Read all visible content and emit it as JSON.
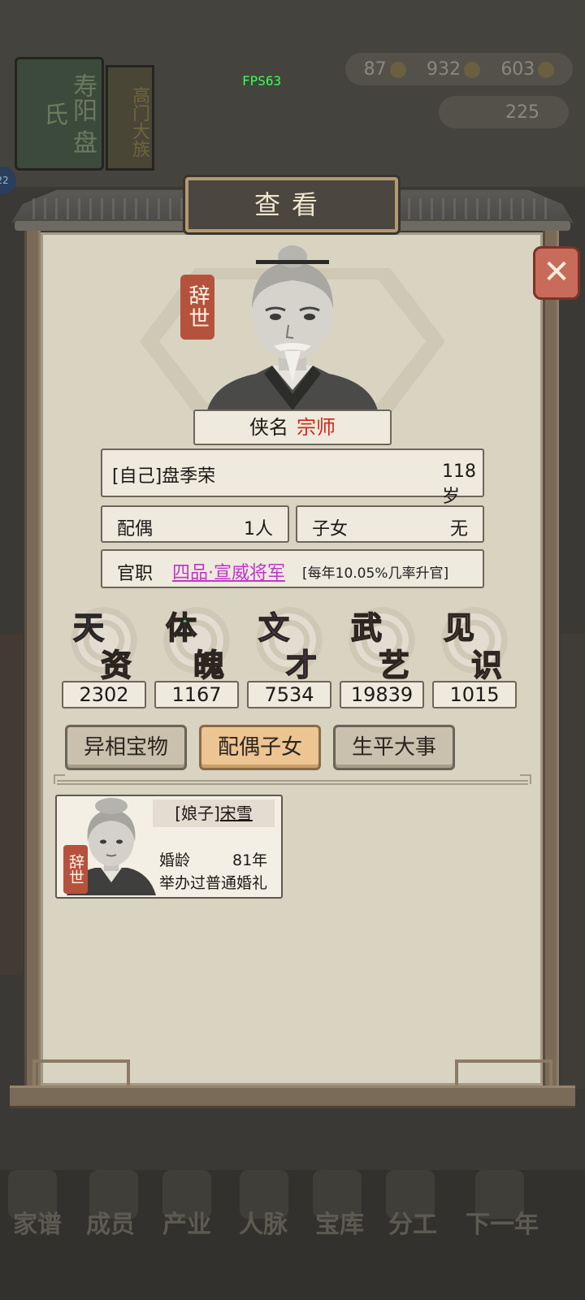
{
  "hud": {
    "fps": "FPS63",
    "currency1": "87",
    "currency2": "932",
    "currency3": "603",
    "currency4": "225",
    "badge": "22"
  },
  "background": {
    "banner_text": "寿阳 盘氏",
    "banner2_text": "高门大族"
  },
  "dialog": {
    "title": "查看",
    "close_label": "✕",
    "status_tag": "辞世",
    "epithet_label": "侠名",
    "epithet_value": "宗师",
    "name": "[自己]盘季荣",
    "age": "118岁",
    "spouse_label": "配偶",
    "spouse_value": "1人",
    "children_label": "子女",
    "children_value": "无",
    "office_label": "官职",
    "office_rank": "四品·宣威将军",
    "office_note": "[每年10.05%几率升官]"
  },
  "stats": [
    {
      "char1": "天",
      "char2": "资",
      "value": "2302",
      "color": "#3c7ad6"
    },
    {
      "char1": "体",
      "char2": "魄",
      "value": "1167",
      "color": "#4fb86a"
    },
    {
      "char1": "文",
      "char2": "才",
      "value": "7534",
      "color": "#b262d8"
    },
    {
      "char1": "武",
      "char2": "艺",
      "value": "19839",
      "color": "#e0a84a"
    },
    {
      "char1": "见",
      "char2": "识",
      "value": "1015",
      "color": "#e07464"
    }
  ],
  "tabs": [
    {
      "label": "异相宝物",
      "active": false
    },
    {
      "label": "配偶子女",
      "active": true
    },
    {
      "label": "生平大事",
      "active": false
    }
  ],
  "spouse_card": {
    "relation": "[娘子]",
    "name": "宋雪",
    "status_tag": "辞世",
    "marriage_label": "婚龄",
    "marriage_years": "81年",
    "wedding_note": "举办过普通婚礼"
  },
  "bottom_nav": [
    {
      "label": "家谱"
    },
    {
      "label": "成员"
    },
    {
      "label": "产业"
    },
    {
      "label": "人脉"
    },
    {
      "label": "宝库"
    },
    {
      "label": "分工"
    },
    {
      "label": "下一年"
    }
  ]
}
